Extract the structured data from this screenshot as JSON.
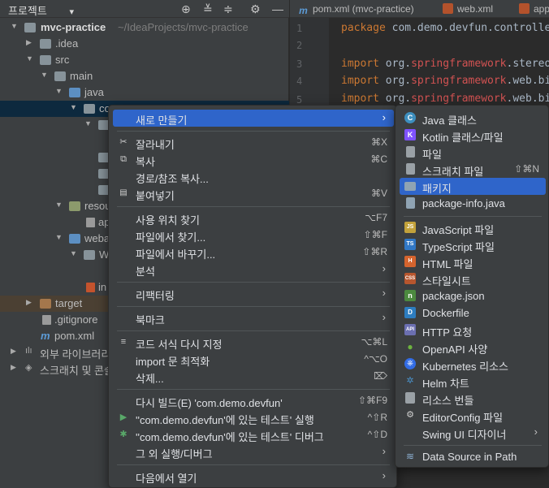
{
  "panel": {
    "title": "프로젝트",
    "title_arrow": "▾",
    "icons": [
      "crosshair-icon",
      "collapse-all-icon",
      "expand-all-icon",
      "close-icon",
      "gear-icon",
      "minimize-icon"
    ]
  },
  "tree": [
    {
      "label": "mvc-practice",
      "path": "~/IdeaProjects/mvc-practice"
    },
    {
      "label": ".idea"
    },
    {
      "label": "src"
    },
    {
      "label": "main"
    },
    {
      "label": "java"
    },
    {
      "label": "co"
    },
    {
      "label": "resou"
    },
    {
      "label": "ap"
    },
    {
      "label": "weba"
    },
    {
      "label": "W"
    },
    {
      "label": "in"
    },
    {
      "label": "target"
    },
    {
      "label": ".gitignore"
    },
    {
      "label": "pom.xml"
    },
    {
      "label": "외부 라이브러리"
    },
    {
      "label": "스크래치 및 콘솔"
    }
  ],
  "editor": {
    "tabs": [
      {
        "label": "pom.xml (mvc-practice)",
        "badge": "m"
      },
      {
        "label": "web.xml",
        "badge": ""
      },
      {
        "label": "app",
        "badge": ""
      }
    ],
    "line_numbers": [
      "1",
      "2",
      "3",
      "4",
      "5"
    ],
    "code": {
      "line1_kw": "package",
      "line1_rest": " com.demo.devfun.controlle",
      "import_kw": "import",
      "line3_a": " org.",
      "line3_spring": "springframework",
      "line3_b": ".stereo",
      "line4_a": " org.",
      "line4_spring": "springframework",
      "line4_b": ".web.bi",
      "line5_a": " org.",
      "line5_spring": "springframework",
      "line5_b": ".web.bi"
    }
  },
  "context_menu": {
    "items": [
      {
        "label": "새로 만들기",
        "submenu": "›",
        "highlighted": true
      },
      {
        "label": "잘라내기",
        "shortcut": "⌘X",
        "icon": "✂"
      },
      {
        "label": "복사",
        "shortcut": "⌘C",
        "icon": "⧉"
      },
      {
        "label": "경로/참조 복사..."
      },
      {
        "label": "붙여넣기",
        "shortcut": "⌘V",
        "icon": "📋"
      },
      {
        "label": "사용 위치 찾기",
        "shortcut": "⌥F7"
      },
      {
        "label": "파일에서 찾기...",
        "shortcut": "⇧⌘F"
      },
      {
        "label": "파일에서 바꾸기...",
        "shortcut": "⇧⌘R"
      },
      {
        "label": "분석",
        "submenu": "›"
      },
      {
        "label": "리팩터링",
        "submenu": "›"
      },
      {
        "label": "북마크",
        "submenu": "›"
      },
      {
        "label": "코드 서식 다시 지정",
        "shortcut": "⌥⌘L",
        "icon": "≡"
      },
      {
        "label": "import 문 최적화",
        "shortcut": "^⌥O"
      },
      {
        "label": "삭제...",
        "shortcut": "⌦"
      },
      {
        "label": "다시 빌드(E) 'com.demo.devfun'",
        "shortcut": "⇧⌘F9"
      },
      {
        "label": "''com.demo.devfun'에 있는 테스트' 실행",
        "shortcut": "^⇧R",
        "icon": "▶"
      },
      {
        "label": "''com.demo.devfun'에 있는 테스트' 디버그",
        "shortcut": "^⇧D",
        "icon": "✱"
      },
      {
        "label": "그 외 실행/디버그",
        "submenu": "›"
      },
      {
        "label": "다음에서 열기",
        "submenu": "›"
      }
    ]
  },
  "submenu": {
    "items": [
      {
        "label": "Java 클래스",
        "icon": "C"
      },
      {
        "label": "Kotlin 클래스/파일",
        "icon": "K"
      },
      {
        "label": "파일",
        "icon": ""
      },
      {
        "label": "스크래치 파일",
        "shortcut": "⇧⌘N",
        "icon": ""
      },
      {
        "label": "패키지",
        "icon": "",
        "highlighted": true
      },
      {
        "label": "package-info.java",
        "icon": ""
      },
      {
        "label": "JavaScript 파일",
        "icon": "JS"
      },
      {
        "label": "TypeScript 파일",
        "icon": "TS"
      },
      {
        "label": "HTML 파일",
        "icon": "H"
      },
      {
        "label": "스타일시트",
        "icon": "CSS"
      },
      {
        "label": "package.json",
        "icon": "n"
      },
      {
        "label": "Dockerfile",
        "icon": "D"
      },
      {
        "label": "HTTP 요청",
        "icon": "API"
      },
      {
        "label": "OpenAPI 사양",
        "icon": "●"
      },
      {
        "label": "Kubernetes 리소스",
        "icon": "⎈"
      },
      {
        "label": "Helm 차트",
        "icon": "✲"
      },
      {
        "label": "리소스 번들",
        "icon": ""
      },
      {
        "label": "EditorConfig 파일",
        "icon": "⚙"
      },
      {
        "label": "Swing UI 디자이너",
        "submenu": "›"
      },
      {
        "label": "Data Source in Path",
        "icon": "≋"
      }
    ]
  },
  "colors": {
    "highlight": "#2f65ca",
    "selected_row": "#0d293e",
    "menu_bg": "#3c3f41",
    "editor_bg": "#2b2b2b",
    "keyword": "#cc7832",
    "spring": "#d25252"
  }
}
